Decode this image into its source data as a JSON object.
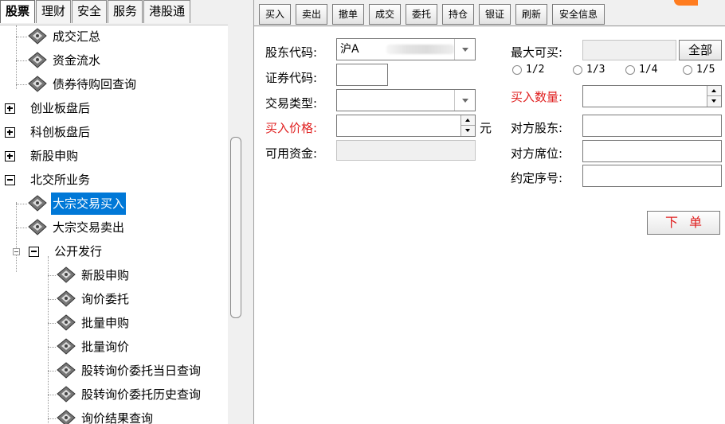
{
  "top_tabs": [
    "股票",
    "理财",
    "安全",
    "服务",
    "港股通"
  ],
  "tree": {
    "items": [
      {
        "label": "成交汇总"
      },
      {
        "label": "资金流水"
      },
      {
        "label": "债券待购回查询"
      },
      {
        "label": "创业板盘后"
      },
      {
        "label": "科创板盘后"
      },
      {
        "label": "新股申购"
      },
      {
        "label": "北交所业务"
      },
      {
        "label": "大宗交易买入",
        "selected": true
      },
      {
        "label": "大宗交易卖出"
      },
      {
        "label": "公开发行"
      },
      {
        "label": "新股申购"
      },
      {
        "label": "询价委托"
      },
      {
        "label": "批量申购"
      },
      {
        "label": "批量询价"
      },
      {
        "label": "股转询价委托当日查询"
      },
      {
        "label": "股转询价委托历史查询"
      },
      {
        "label": "询价结果查询"
      }
    ]
  },
  "toolbar": [
    "买入",
    "卖出",
    "撤单",
    "成交",
    "委托",
    "持仓",
    "银证",
    "刷新",
    "安全信息"
  ],
  "form": {
    "shareholder_code_label": "股东代码:",
    "shareholder_code_value": "沪A",
    "security_code_label": "证券代码:",
    "trade_type_label": "交易类型:",
    "buy_price_label": "买入价格:",
    "price_unit": "元",
    "available_funds_label": "可用资金:",
    "max_buy_label": "最大可买:",
    "all_button": "全部",
    "fractions": [
      "1/2",
      "1/3",
      "1/4",
      "1/5"
    ],
    "buy_qty_label": "买入数量:",
    "counterparty_holder_label": "对方股东:",
    "counterparty_seat_label": "对方席位:",
    "agreement_no_label": "约定序号:",
    "order_button": "下单"
  },
  "colors": {
    "accent": "#0078d7",
    "warning_red": "#e02020",
    "orange": "#ff7c1f"
  },
  "icons": {
    "leaf": "gear-node-icon"
  }
}
